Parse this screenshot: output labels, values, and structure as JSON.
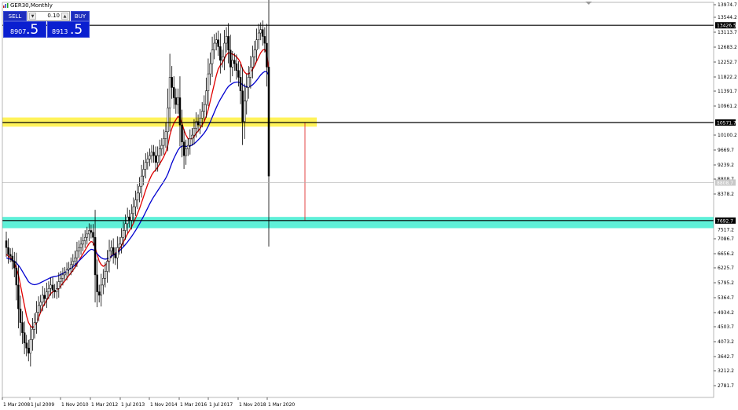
{
  "header": {
    "symbol_title": "GER30,Monthly",
    "icon": "chart-window-icon"
  },
  "trade_panel": {
    "sell_label": "SELL",
    "buy_label": "BUY",
    "lot_value": "0.10",
    "sell_price_small": "8907",
    "sell_price_big": ".5",
    "buy_price_small": "8913",
    "buy_price_big": ".5"
  },
  "colors": {
    "candles": "#000000",
    "ma_fast": "#e00000",
    "ma_slow": "#0000d0",
    "resistance_zone": "#fff35a",
    "support_zone": "#5ef0d8",
    "panel_blue": "#0a1fd0"
  },
  "chart_data": {
    "type": "candlestick",
    "y_axis_labels": [
      "13974.7",
      "13544.2",
      "13113.7",
      "12683.2",
      "12252.7",
      "11822.2",
      "11391.7",
      "10961.2",
      "10100.2",
      "9669.7",
      "9239.2",
      "8808.7",
      "8378.2",
      "7086.7",
      "6656.2",
      "6225.7",
      "5795.2",
      "5364.7",
      "4934.2",
      "4503.7",
      "4073.2",
      "3642.7",
      "3212.2",
      "2781.7"
    ],
    "x_axis_labels": [
      "1 Mar 2008",
      "1 Jul 2009",
      "1 Nov 2010",
      "1 Mar 2012",
      "1 Jul 2013",
      "1 Nov 2014",
      "1 Mar 2016",
      "1 Jul 2017",
      "1 Nov 2018",
      "1 Mar 2020"
    ],
    "ylim": [
      2500,
      14100
    ],
    "current_price_label": "8808.7",
    "price_levels": [
      {
        "label": "13426.5",
        "value": 13426.5,
        "color": "#000000"
      },
      {
        "label": "10571.7",
        "value": 10571.7,
        "color": "#000000"
      },
      {
        "label": "7692.7",
        "value": 7692.7,
        "color": "#000000"
      }
    ],
    "zones": [
      {
        "name": "resistance",
        "low": 10450,
        "high": 10720,
        "color": "#fff35a"
      },
      {
        "name": "support",
        "low": 7470,
        "high": 7800,
        "color": "#5ef0d8"
      }
    ],
    "extra_label": "7517.2",
    "closes": [
      6900,
      6700,
      6650,
      6500,
      6300,
      5800,
      5100,
      4700,
      4400,
      4100,
      3950,
      3800,
      4200,
      4500,
      4700,
      5000,
      5200,
      5300,
      5500,
      5400,
      5600,
      5700,
      5800,
      5650,
      5600,
      5700,
      5900,
      6000,
      6100,
      6150,
      6250,
      6300,
      6400,
      6500,
      6600,
      6800,
      6900,
      7000,
      7100,
      7200,
      7300,
      7400,
      7350,
      7200,
      6100,
      5600,
      5500,
      5800,
      6000,
      6200,
      6500,
      6800,
      6900,
      6700,
      6600,
      6900,
      7000,
      7200,
      7400,
      7600,
      7800,
      7700,
      7900,
      8100,
      8300,
      8500,
      8700,
      9000,
      9200,
      9400,
      9500,
      9600,
      9700,
      9600,
      9400,
      9600,
      9800,
      9900,
      10100,
      10300,
      11000,
      11900,
      11600,
      11300,
      11100,
      11300,
      10500,
      10000,
      9600,
      9800,
      9900,
      10100,
      10200,
      10400,
      10600,
      10500,
      10700,
      10900,
      11100,
      11500,
      12000,
      12300,
      12700,
      12900,
      13000,
      12800,
      12400,
      12500,
      12900,
      13100,
      12700,
      12200,
      12400,
      12300,
      12100,
      11900,
      11500,
      10600,
      11200,
      11600,
      11900,
      12200,
      12500,
      12700,
      13000,
      13200,
      13300,
      13100,
      12900,
      12200,
      9000
    ],
    "ma_fast": [
      6700,
      6650,
      6600,
      6550,
      6450,
      6300,
      6100,
      5800,
      5500,
      5200,
      4900,
      4700,
      4600,
      4550,
      4600,
      4700,
      4850,
      5000,
      5150,
      5250,
      5350,
      5450,
      5550,
      5600,
      5620,
      5650,
      5700,
      5780,
      5850,
      5920,
      6000,
      6080,
      6150,
      6230,
      6320,
      6420,
      6520,
      6620,
      6720,
      6820,
      6920,
      7020,
      7080,
      7050,
      6900,
      6700,
      6500,
      6400,
      6350,
      6380,
      6450,
      6560,
      6650,
      6700,
      6720,
      6780,
      6850,
      6950,
      7060,
      7180,
      7300,
      7400,
      7500,
      7620,
      7760,
      7900,
      8050,
      8220,
      8400,
      8580,
      8750,
      8900,
      9030,
      9120,
      9180,
      9260,
      9360,
      9460,
      9570,
      9700,
      9900,
      10200,
      10400,
      10550,
      10650,
      10750,
      10700,
      10550,
      10350,
      10200,
      10100,
      10080,
      10100,
      10160,
      10250,
      10320,
      10400,
      10500,
      10600,
      10750,
      10950,
      11200,
      11450,
      11700,
      11950,
      12150,
      12250,
      12330,
      12440,
      12560,
      12620,
      12600,
      12580,
      12550,
      12500,
      12430,
      12330,
      12150,
      12050,
      12000,
      12000,
      12050,
      12130,
      12240,
      12370,
      12500,
      12620,
      12700,
      12720,
      12600,
      12100
    ],
    "ma_slow": [
      6600,
      6580,
      6560,
      6530,
      6500,
      6450,
      6380,
      6300,
      6200,
      6100,
      6000,
      5900,
      5850,
      5820,
      5810,
      5820,
      5840,
      5870,
      5900,
      5930,
      5960,
      5990,
      6020,
      6040,
      6050,
      6060,
      6080,
      6110,
      6140,
      6170,
      6210,
      6250,
      6290,
      6340,
      6390,
      6450,
      6510,
      6570,
      6630,
      6690,
      6750,
      6810,
      6850,
      6840,
      6790,
      6720,
      6650,
      6600,
      6570,
      6560,
      6570,
      6600,
      6640,
      6680,
      6710,
      6750,
      6800,
      6860,
      6920,
      6990,
      7060,
      7140,
      7220,
      7310,
      7400,
      7500,
      7600,
      7710,
      7820,
      7940,
      8060,
      8180,
      8290,
      8390,
      8480,
      8570,
      8660,
      8750,
      8840,
      8940,
      9060,
      9220,
      9380,
      9520,
      9640,
      9760,
      9840,
      9880,
      9880,
      9870,
      9870,
      9880,
      9910,
      9950,
      10000,
      10060,
      10120,
      10190,
      10260,
      10350,
      10460,
      10590,
      10730,
      10870,
      11010,
      11140,
      11250,
      11350,
      11450,
      11550,
      11630,
      11680,
      11720,
      11750,
      11760,
      11760,
      11740,
      11680,
      11640,
      11620,
      11620,
      11640,
      11680,
      11740,
      11810,
      11890,
      11970,
      12030,
      12070,
      12060,
      11950
    ],
    "drop_projection": {
      "from": 10571.7,
      "to": 7692.7
    }
  }
}
